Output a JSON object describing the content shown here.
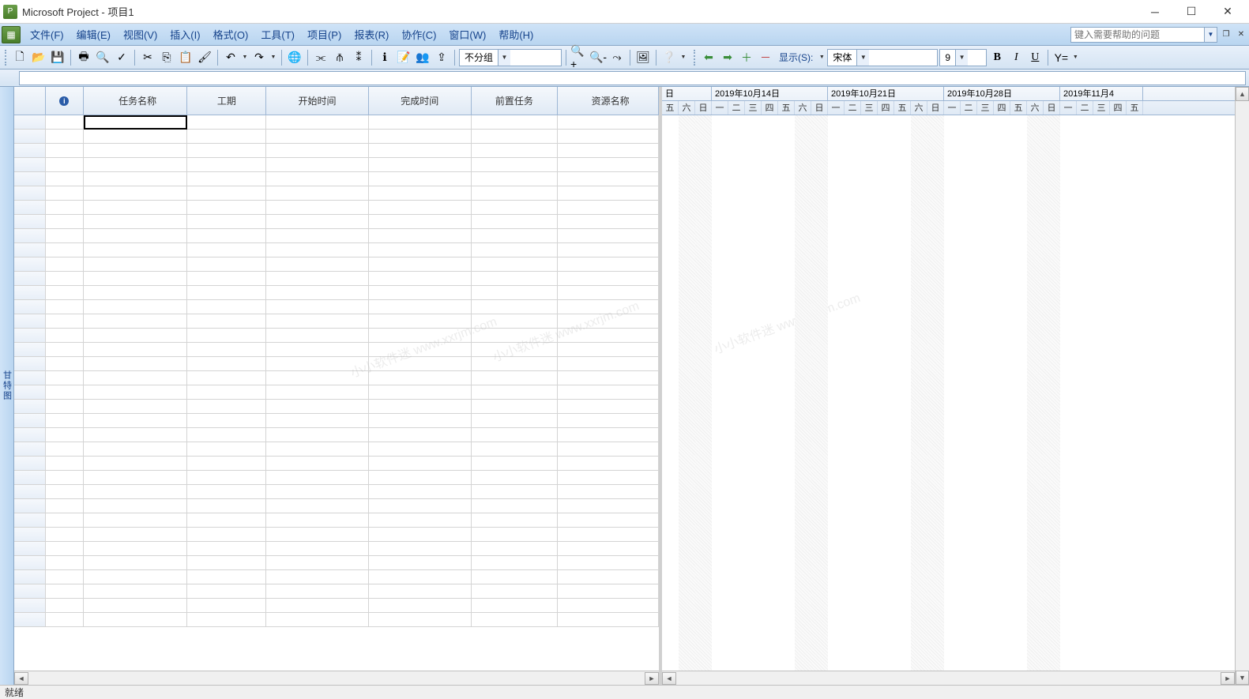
{
  "title": "Microsoft Project - 项目1",
  "menu": {
    "file": "文件(F)",
    "edit": "编辑(E)",
    "view": "视图(V)",
    "insert": "插入(I)",
    "format": "格式(O)",
    "tools": "工具(T)",
    "project": "项目(P)",
    "report": "报表(R)",
    "collab": "协作(C)",
    "window": "窗口(W)",
    "help": "帮助(H)"
  },
  "help_placeholder": "键入需要帮助的问题",
  "toolbar": {
    "group_combo": "不分组",
    "show_label": "显示(S):",
    "font_combo": "宋体",
    "size_combo": "9"
  },
  "sidebar_label": "甘特图",
  "columns": {
    "task": "任务名称",
    "duration": "工期",
    "start": "开始时间",
    "finish": "完成时间",
    "pred": "前置任务",
    "res": "资源名称"
  },
  "gantt": {
    "weeks": [
      {
        "label": "日",
        "days": 3
      },
      {
        "label": "2019年10月14日",
        "days": 7
      },
      {
        "label": "2019年10月21日",
        "days": 7
      },
      {
        "label": "2019年10月28日",
        "days": 7
      },
      {
        "label": "2019年11月4",
        "days": 5
      }
    ],
    "day_labels_first": [
      "五",
      "六",
      "日"
    ],
    "day_labels_week": [
      "一",
      "二",
      "三",
      "四",
      "五",
      "六",
      "日"
    ]
  },
  "status": "就绪",
  "watermark": "小小软件迷 www.xxrjm.com"
}
